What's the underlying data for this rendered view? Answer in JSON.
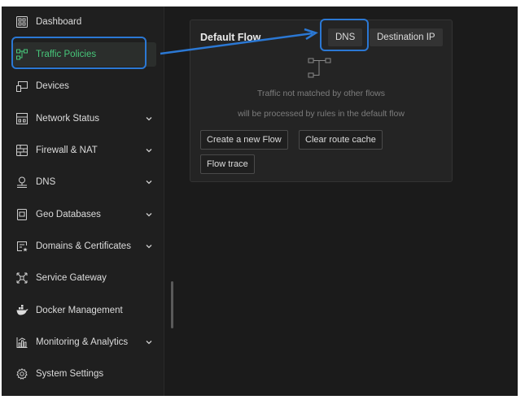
{
  "sidebar": {
    "items": [
      {
        "label": "Dashboard",
        "icon": "dashboard-icon",
        "chevron": false
      },
      {
        "label": "Traffic Policies",
        "icon": "route-icon",
        "chevron": false,
        "active": true
      },
      {
        "label": "Devices",
        "icon": "devices-icon",
        "chevron": false
      },
      {
        "label": "Network Status",
        "icon": "network-icon",
        "chevron": true
      },
      {
        "label": "Firewall & NAT",
        "icon": "firewall-icon",
        "chevron": true
      },
      {
        "label": "DNS",
        "icon": "dns-icon",
        "chevron": true
      },
      {
        "label": "Geo Databases",
        "icon": "geo-database-icon",
        "chevron": true
      },
      {
        "label": "Domains & Certificates",
        "icon": "certificate-icon",
        "chevron": true
      },
      {
        "label": "Service Gateway",
        "icon": "gateway-icon",
        "chevron": false
      },
      {
        "label": "Docker Management",
        "icon": "docker-icon",
        "chevron": false
      },
      {
        "label": "Monitoring & Analytics",
        "icon": "monitoring-icon",
        "chevron": true
      },
      {
        "label": "System Settings",
        "icon": "settings-icon",
        "chevron": false
      }
    ]
  },
  "card": {
    "title": "Default Flow",
    "tabs": [
      "DNS",
      "Destination IP"
    ],
    "note_line1": "Traffic not matched by other flows",
    "note_line2": "will be processed by rules in the default flow",
    "buttons": {
      "create": "Create a new Flow",
      "clear": "Clear route cache",
      "trace": "Flow trace"
    }
  },
  "colors": {
    "accent_green": "#47c77a",
    "annotation_blue": "#2b78d4",
    "background": "#1b1b1b"
  }
}
